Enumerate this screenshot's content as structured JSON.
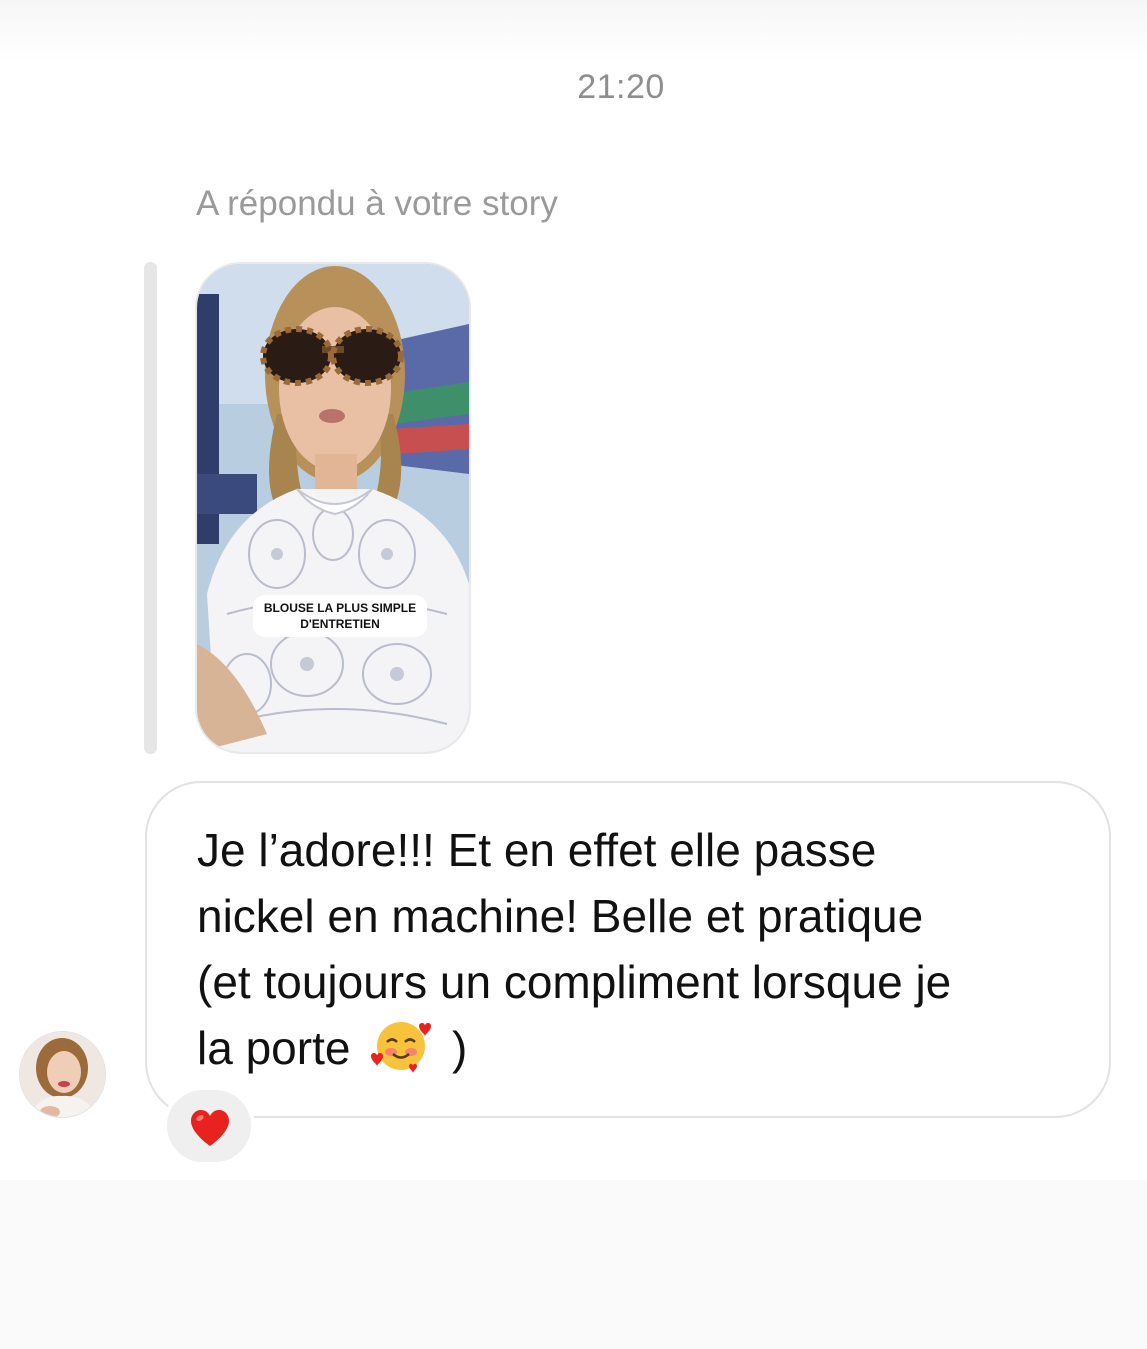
{
  "timestamp": "21:20",
  "reply_label": "A répondu à votre story",
  "story": {
    "caption_line1": "BLOUSE LA PLUS SIMPLE",
    "caption_line2": "D'ENTRETIEN"
  },
  "message": {
    "lines": [
      "Je l’adore!!! Et en effet elle passe",
      "nickel en machine! Belle et pratique",
      "(et toujours un compliment lorsque je"
    ],
    "last_line_before_emoji": "la porte",
    "emoji": "smiling-face-with-hearts-icon",
    "last_line_after_emoji": ")"
  },
  "reaction": {
    "icon": "red-heart-icon",
    "color": "#e8231f"
  },
  "colors": {
    "meta_text": "#8e8e8e",
    "bubble_border": "#e2e2e2",
    "reaction_bg": "#efefef",
    "quote_bar": "#e6e6e6"
  }
}
